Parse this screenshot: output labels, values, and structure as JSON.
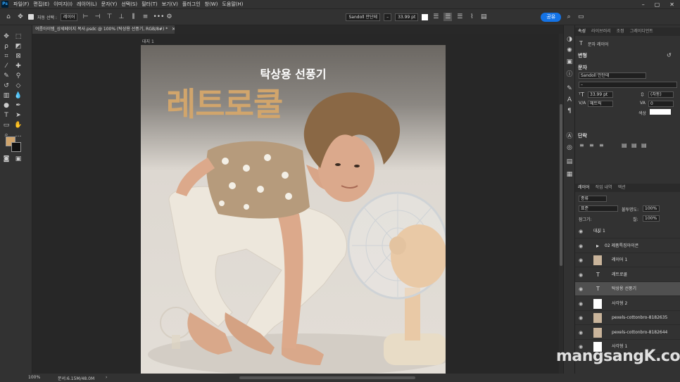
{
  "app": {
    "logo": "Ps"
  },
  "menu": [
    "파일(F)",
    "편집(E)",
    "이미지(I)",
    "레이어(L)",
    "문자(Y)",
    "선택(S)",
    "필터(T)",
    "보기(V)",
    "플러그인",
    "창(W)",
    "도움말(H)"
  ],
  "window_controls": {
    "minimize": "–",
    "maximize": "▢",
    "close": "✕"
  },
  "options": {
    "auto_select_label": "자동 선택 :",
    "auto_select_value": "레이어",
    "more": "•••",
    "font_family": "Sandoll 만단테",
    "font_style": "–",
    "font_size": "33.99 pt",
    "share": "공유"
  },
  "tab": {
    "title": "여름아이템_상세페이지 복사.psdc @ 100% (탁상용 선풍기, RGB/8#) *",
    "close": "✕"
  },
  "artboard": {
    "label": "대지 1"
  },
  "document": {
    "subtitle": "탁상용 선풍기",
    "title": "레트로쿨",
    "title_color": "#d1a56c"
  },
  "watermark": "mangsangK.com",
  "status": {
    "zoom": "100%",
    "doc_size": "문서:6.15M/48.0M",
    "arrow": "›"
  },
  "panel": {
    "tabs": [
      "속성",
      "라이브러리",
      "조정",
      "그레이디언트"
    ],
    "kind_label": "문자 레이어",
    "transform_label": "변형",
    "char_label": "문자",
    "font_family": "Sandoll 만단테",
    "font_style": "–",
    "font_size": "33.99 pt",
    "leading": "(자동)",
    "kerning": "메트릭",
    "tracking": "0",
    "color_label": "색상",
    "para_label": "단락",
    "layers_tabs": [
      "레이어",
      "작업 내역",
      "액션"
    ],
    "filter_value": "종류",
    "blend_mode": "표준",
    "opacity_label": "불투명도:",
    "opacity": "100%",
    "lock_label": "잠그기:",
    "fill_label": "칠:",
    "fill": "100%",
    "layers": [
      {
        "name": "대지 1",
        "type": "artboard"
      },
      {
        "name": "02 제품특징아이콘",
        "type": "group"
      },
      {
        "name": "레이어 1",
        "type": "pixel"
      },
      {
        "name": "레트로쿨",
        "type": "text"
      },
      {
        "name": "탁상용 선풍기",
        "type": "text",
        "selected": true
      },
      {
        "name": "사각형 2",
        "type": "shape"
      },
      {
        "name": "pexels-cottonbro-8182635",
        "type": "pixel"
      },
      {
        "name": "pexels-cottonbro-8182644",
        "type": "pixel"
      },
      {
        "name": "사각형 1",
        "type": "shape"
      }
    ]
  },
  "colors": {
    "foreground": "#d1a56c",
    "background": "#111111",
    "accent": "#1473e6"
  }
}
